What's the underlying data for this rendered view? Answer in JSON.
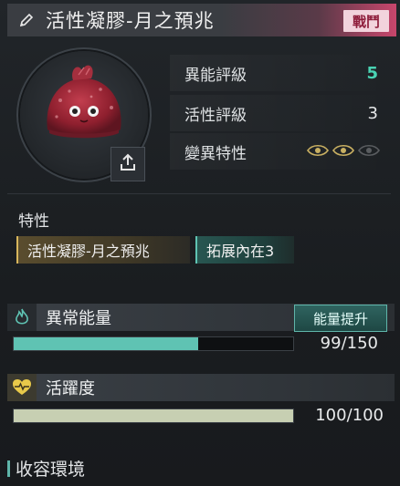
{
  "header": {
    "title": "活性凝膠-月之預兆",
    "badge": "戰鬥"
  },
  "ratings": [
    {
      "label": "異能評級",
      "value": "5",
      "color": "#49d3b3"
    },
    {
      "label": "活性評級",
      "value": "3",
      "color": "#e6e8e9"
    },
    {
      "label": "變異特性",
      "eyes_active": 2,
      "eyes_total": 3
    }
  ],
  "traits": {
    "title": "特性",
    "tags": [
      "活性凝膠-月之預兆",
      "拓展內在3"
    ]
  },
  "energy": {
    "label": "異常能量",
    "button": "能量提升",
    "value_text": "99/150",
    "current": 99,
    "max": 150,
    "fill_color": "#5fc3b3"
  },
  "vitality": {
    "label": "活躍度",
    "value_text": "100/100",
    "current": 100,
    "max": 100,
    "fill_color": "#c7cfb2"
  },
  "environment": {
    "title": "收容環境"
  },
  "icons": {
    "edit": "pencil-icon",
    "upload": "upload-icon",
    "energy": "flame-icon",
    "vitality": "heart-pulse-icon",
    "mutation": "eye-icon"
  }
}
